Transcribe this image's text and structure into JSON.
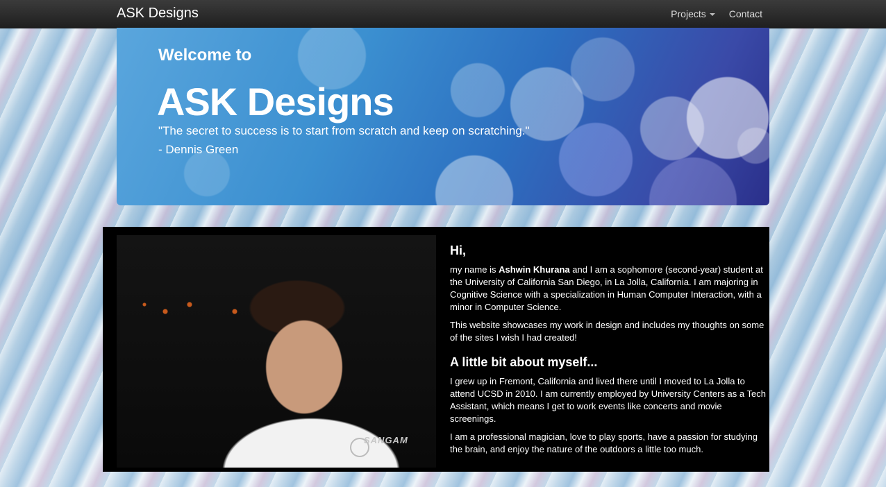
{
  "navbar": {
    "brand": "ASK Designs",
    "links": [
      {
        "label": "Projects",
        "has_dropdown": true
      },
      {
        "label": "Contact",
        "has_dropdown": false
      }
    ]
  },
  "hero": {
    "welcome": "Welcome to",
    "title": "ASK Designs",
    "quote": "\"The secret to success is to start from scratch and keep on scratching.\"",
    "author": "- Dennis Green"
  },
  "profile": {
    "photo_watermark": "SANGAM",
    "greeting": "Hi,",
    "intro_prefix": "my name is ",
    "name": "Ashwin Khurana",
    "intro_suffix": " and I am a sophomore (second-year) student at the University of California San Diego, in La Jolla, California. I am majoring in Cognitive Science with a specialization in Human Computer Interaction, with a minor in Computer Science.",
    "showcase": "This website showcases my work in design and includes my thoughts on some of the sites I wish I had created!",
    "about_heading": "A little bit about myself...",
    "about_p1": "I grew up in Fremont, California and lived there until I moved to La Jolla to attend UCSD in 2010. I am currently employed by University Centers as a Tech Assistant, which means I get to work events like concerts and movie screenings.",
    "about_p2": "I am a professional magician, love to play sports, have a passion for studying the brain, and enjoy the nature of the outdoors a little too much."
  },
  "colors": {
    "navbar": "#222222",
    "hero_blue": "#3b8fd0",
    "content_bg": "#000000"
  }
}
